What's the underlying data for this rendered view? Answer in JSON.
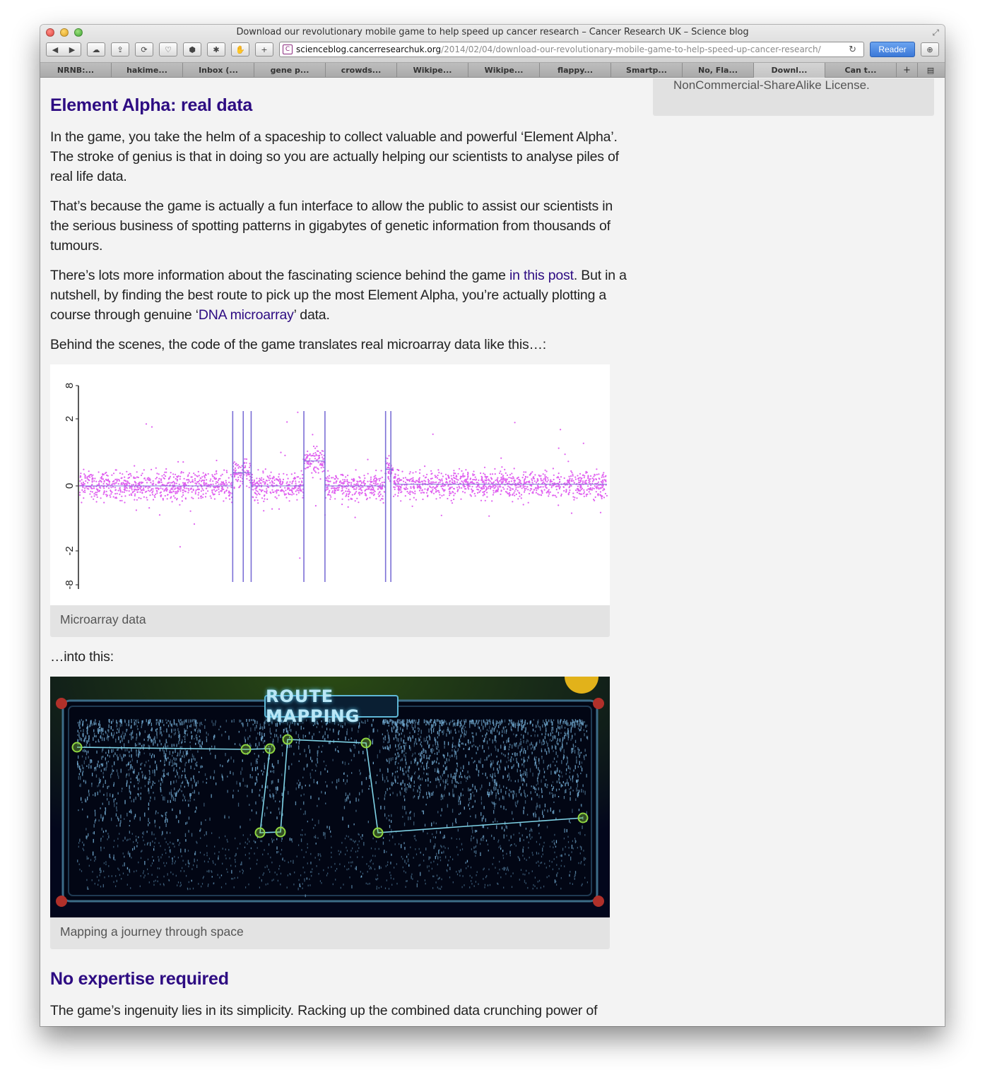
{
  "browser": {
    "window_title": "Download our revolutionary mobile game to help speed up cancer research – Cancer Research UK – Science blog",
    "url_domain": "scienceblog.cancerresearchuk.org",
    "url_path": "/2014/02/04/download-our-revolutionary-mobile-game-to-help-speed-up-cancer-research/",
    "reader_label": "Reader",
    "tabs": [
      "NRNB:...",
      "hakime...",
      "Inbox (...",
      "gene p...",
      "crowds...",
      "Wikipe...",
      "Wikipe...",
      "flappy...",
      "Smartp...",
      "No, Fla...",
      "Downl...",
      "Can t..."
    ],
    "active_tab_index": 10
  },
  "sidebar": {
    "license_text": "NonCommercial-ShareAlike License."
  },
  "article": {
    "heading1": "Element Alpha: real data",
    "para1": "In the game, you take the helm of a spaceship to collect valuable and powerful ‘Element Alpha’. The stroke of genius is that in doing so you are actually helping our scientists to analyse piles of real life data.",
    "para2": "That’s because the game is actually a fun interface to allow the public to assist our scientists in the serious business of spotting patterns in gigabytes of genetic information from thousands of tumours.",
    "para3_before": "There’s lots more information about the fascinating science behind the game ",
    "para3_link1": "in this post",
    "para3_middle": ". But in a nutshell, by finding the best route to pick up the most Element Alpha, you’re actually plotting a course through genuine ‘",
    "para3_link2": "DNA microarray",
    "para3_after": "’ data.",
    "para4": "Behind the scenes, the code of the game translates real microarray data like this…:",
    "figure1_caption": "Microarray data",
    "into_this": "…into this:",
    "figure2_caption": "Mapping a journey through space",
    "game_header_text": "ROUTE MAPPING",
    "heading2": "No expertise required",
    "para5": "The game’s ingenuity lies in its simplicity. Racking up the combined data crunching power of"
  },
  "colors": {
    "heading": "#2d0b82",
    "scatter_points": "#e060f0",
    "segment_lines": "#7b6fd6",
    "game_route": "#7fd3e6",
    "game_node": "#8fd640"
  },
  "chart_data": {
    "type": "scatter",
    "title": "",
    "xlabel": "",
    "ylabel": "",
    "y_ticks": [
      "8",
      "2",
      "0",
      "-2",
      "-8"
    ],
    "y_scale": "piecewise (compressed beyond ±2)",
    "series": [
      {
        "color": "#e060f0",
        "segments": [
          {
            "x_start": 0.0,
            "x_end": 0.29,
            "mean": 0.0
          },
          {
            "x_start": 0.29,
            "x_end": 0.325,
            "mean": 0.4
          },
          {
            "x_start": 0.325,
            "x_end": 0.425,
            "mean": 0.0
          },
          {
            "x_start": 0.425,
            "x_end": 0.465,
            "mean": 0.75
          },
          {
            "x_start": 0.465,
            "x_end": 0.58,
            "mean": 0.0
          },
          {
            "x_start": 0.58,
            "x_end": 0.595,
            "mean": 0.5
          },
          {
            "x_start": 0.595,
            "x_end": 1.0,
            "mean": 0.05
          }
        ]
      }
    ],
    "breakpoints": [
      0.29,
      0.31,
      0.325,
      0.425,
      0.465,
      0.58,
      0.59
    ],
    "grid": false
  }
}
